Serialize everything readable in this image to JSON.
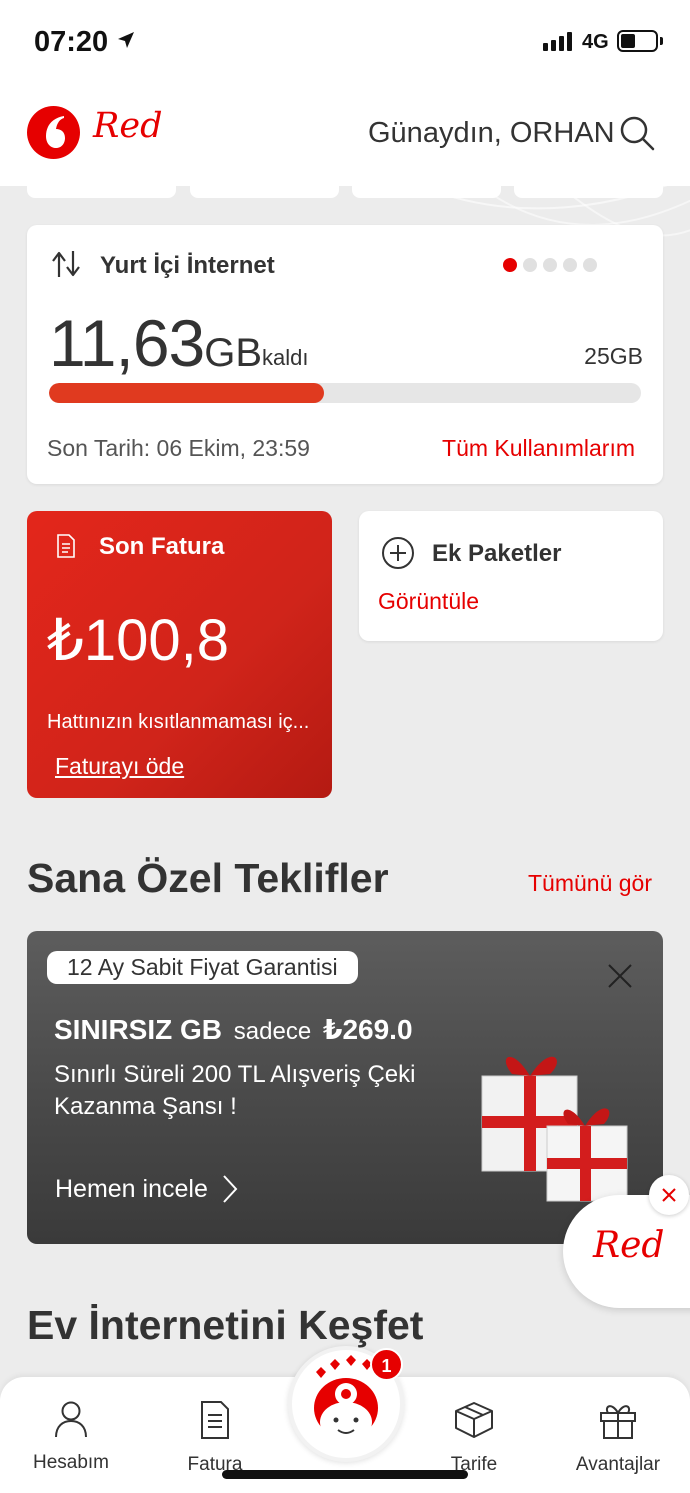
{
  "status_bar": {
    "time": "07:20",
    "network": "4G"
  },
  "header": {
    "brand": "Red",
    "greeting": "Günaydın, ORHAN"
  },
  "internet_card": {
    "title": "Yurt İçi İnternet",
    "remaining_number": "11,63",
    "remaining_unit": "GB",
    "remaining_suffix": "kaldı",
    "total": "25GB",
    "usage_fraction": 0.465,
    "deadline": "Son Tarih: 06 Ekim, 23:59",
    "all_usage_link": "Tüm Kullanımlarım",
    "pager_active_index": 0,
    "pager_count": 5
  },
  "invoice_card": {
    "title": "Son Fatura",
    "amount": "₺100,8",
    "description": "Hattınızın kısıtlanmaması iç...",
    "pay_link": "Faturayı öde"
  },
  "addon_card": {
    "title": "Ek Paketler",
    "link": "Görüntüle"
  },
  "offers": {
    "section_title": "Sana Özel Teklifler",
    "see_all": "Tümünü gör",
    "badge": "12 Ay Sabit Fiyat Garantisi",
    "headline_bold": "SINIRSIZ GB",
    "headline_mid": "sadece",
    "headline_price": "₺269.0",
    "description": "Sınırlı Süreli 200 TL Alışveriş Çeki Kazanma Şansı !",
    "cta": "Hemen incele"
  },
  "floating_button": {
    "label": "Red"
  },
  "explore": {
    "section_title": "Ev İnternetini Keşfet"
  },
  "tab_bar": {
    "items": [
      {
        "label": "Hesabım",
        "icon": "person-icon"
      },
      {
        "label": "Fatura",
        "icon": "invoice-icon"
      },
      {
        "label": "Tarife",
        "icon": "box-icon"
      },
      {
        "label": "Avantajlar",
        "icon": "gift-icon"
      }
    ],
    "notification_count": "1"
  },
  "colors": {
    "accent": "#e60000",
    "background": "#ececec",
    "offer_bg": "#4a4a4a"
  }
}
